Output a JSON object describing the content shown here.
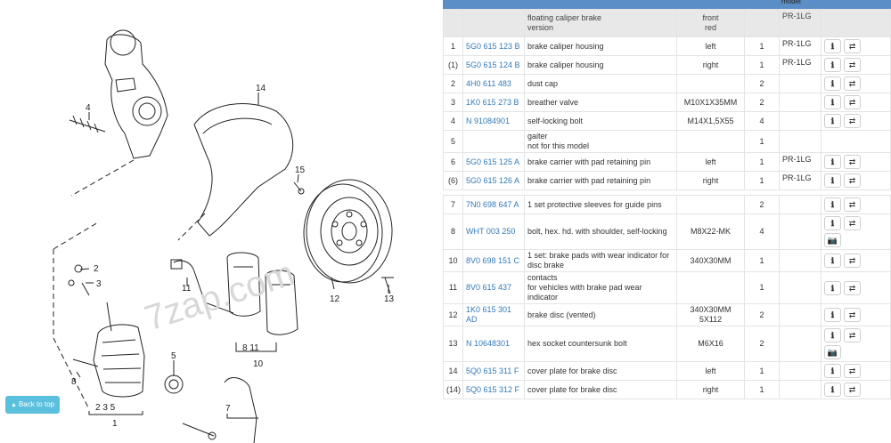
{
  "diagram": {
    "watermark": "7zap.com",
    "callouts": [
      "14",
      "4",
      "15",
      "12",
      "13",
      "2",
      "3",
      "11",
      "5",
      "8",
      "10",
      "7",
      "1",
      "2 3 5",
      "8 11"
    ],
    "back_to_top_label": "Back to top"
  },
  "table": {
    "header_model_label": "model",
    "header": {
      "name": "floating caliper brake",
      "name2": "version",
      "note": "front",
      "note2": "red",
      "model": "PR-1LG"
    },
    "rows": [
      {
        "num": "1",
        "code": "5G0 615 123 B",
        "name": "brake caliper housing",
        "name2": "",
        "note": "left",
        "note2": "",
        "qty": "1",
        "model": "PR-1LG",
        "buttons": [
          "info",
          "swap"
        ]
      },
      {
        "num": "(1)",
        "code": "5G0 615 124 B",
        "name": "brake caliper housing",
        "name2": "",
        "note": "right",
        "note2": "",
        "qty": "1",
        "model": "PR-1LG",
        "buttons": [
          "info",
          "swap"
        ]
      },
      {
        "num": "2",
        "code": "4H0 611 483",
        "name": "dust cap",
        "name2": "",
        "note": "",
        "note2": "",
        "qty": "2",
        "model": "",
        "buttons": [
          "info",
          "swap"
        ]
      },
      {
        "num": "3",
        "code": "1K0 615 273 B",
        "name": "breather valve",
        "name2": "",
        "note": "M10X1X35MM",
        "note2": "",
        "qty": "2",
        "model": "",
        "buttons": [
          "info",
          "swap"
        ]
      },
      {
        "num": "4",
        "code": "N  91084901",
        "name": "self-locking bolt",
        "name2": "",
        "note": "M14X1,5X55",
        "note2": "",
        "qty": "4",
        "model": "",
        "buttons": [
          "info",
          "swap"
        ]
      },
      {
        "num": "5",
        "code": "",
        "name": "gaiter",
        "name2": "not for this model",
        "note": "",
        "note2": "",
        "qty": "1",
        "model": "",
        "buttons": []
      },
      {
        "num": "6",
        "code": "5G0 615 125 A",
        "name": "brake carrier with pad retaining pin",
        "name2": "",
        "note": "left",
        "note2": "",
        "qty": "1",
        "model": "PR-1LG",
        "buttons": [
          "info",
          "swap"
        ]
      },
      {
        "num": "(6)",
        "code": "5G0 615 126 A",
        "name": "brake carrier with pad retaining pin",
        "name2": "",
        "note": "right",
        "note2": "",
        "qty": "1",
        "model": "PR-1LG",
        "buttons": [
          "info",
          "swap"
        ]
      },
      {
        "gap": true
      },
      {
        "num": "7",
        "code": "7N0 698 647 A",
        "name": "1 set protective sleeves for guide pins",
        "name2": "",
        "note": "",
        "note2": "",
        "qty": "2",
        "model": "",
        "buttons": [
          "info",
          "swap"
        ]
      },
      {
        "num": "8",
        "code": "WHT 003 250",
        "name": "bolt, hex. hd. with shoulder, self-locking",
        "name2": "",
        "note": "M8X22-MK",
        "note2": "",
        "qty": "4",
        "model": "",
        "buttons": [
          "info",
          "swap",
          "camera"
        ]
      },
      {
        "num": "10",
        "code": "8V0 698 151 C",
        "name": "1 set: brake pads with wear indicator for disc brake",
        "name2": "",
        "note": "340X30MM",
        "note2": "",
        "qty": "1",
        "model": "",
        "buttons": [
          "info",
          "swap"
        ]
      },
      {
        "num": "11",
        "code": "8V0 615 437",
        "name": "contacts",
        "name2": "for vehicles with brake pad wear indicator",
        "note": "",
        "note2": "",
        "qty": "1",
        "model": "",
        "buttons": [
          "info",
          "swap"
        ]
      },
      {
        "num": "12",
        "code": "1K0 615 301 AD",
        "name": "brake disc (vented)",
        "name2": "",
        "note": "340X30MM",
        "note2": "5X112",
        "qty": "2",
        "model": "",
        "buttons": [
          "info",
          "swap"
        ]
      },
      {
        "num": "13",
        "code": "N  10648301",
        "name": "hex socket countersunk bolt",
        "name2": "",
        "note": "M6X16",
        "note2": "",
        "qty": "2",
        "model": "",
        "buttons": [
          "info",
          "swap",
          "camera"
        ]
      },
      {
        "num": "14",
        "code": "5Q0 615 311 F",
        "name": "cover plate for brake disc",
        "name2": "",
        "note": "left",
        "note2": "",
        "qty": "1",
        "model": "",
        "buttons": [
          "info",
          "swap"
        ]
      },
      {
        "num": "(14)",
        "code": "5Q0 615 312 F",
        "name": "cover plate for brake disc",
        "name2": "",
        "note": "right",
        "note2": "",
        "qty": "1",
        "model": "",
        "buttons": [
          "info",
          "swap"
        ]
      }
    ]
  },
  "icons": {
    "info": "info-icon",
    "swap": "swap-icon",
    "camera": "camera-icon"
  },
  "colors": {
    "link": "#337ab7",
    "header_strip": "#5b8ec7",
    "back_to_top": "#5bc0de"
  }
}
